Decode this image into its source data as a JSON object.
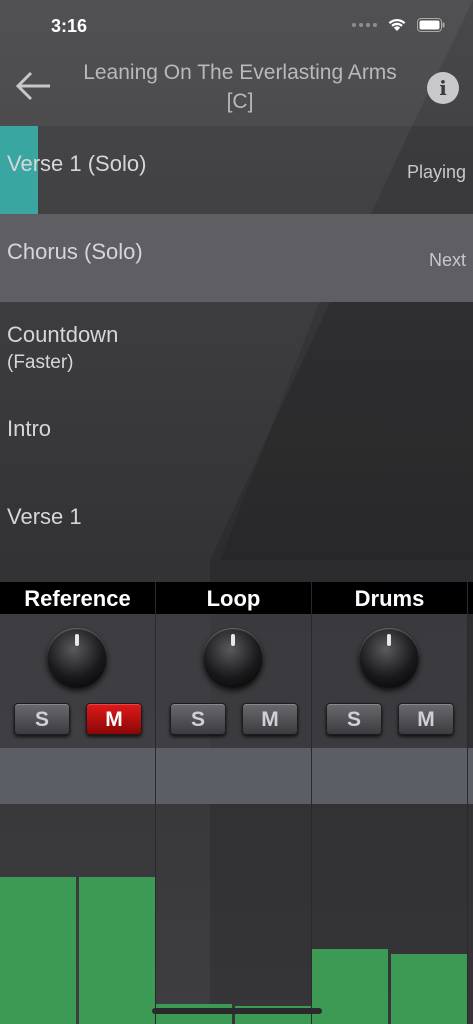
{
  "status_bar": {
    "time": "3:16"
  },
  "header": {
    "title_line1": "Leaning On The Everlasting Arms",
    "title_line2": "[C]",
    "back_icon": "arrow-left-icon",
    "info_glyph": "i"
  },
  "sections": [
    {
      "label": "Verse 1 (Solo)",
      "state": "Playing",
      "progress": 0.08
    },
    {
      "label": "Chorus (Solo)",
      "state": "Next"
    },
    {
      "label": "Countdown",
      "sublabel": "(Faster)",
      "state": ""
    },
    {
      "label": "Intro",
      "state": ""
    },
    {
      "label": "Verse 1",
      "state": ""
    }
  ],
  "channels": [
    {
      "name": "Reference",
      "solo_label": "S",
      "mute_label": "M",
      "muted": true,
      "levels": [
        0.67,
        0.67
      ]
    },
    {
      "name": "Loop",
      "solo_label": "S",
      "mute_label": "M",
      "muted": false,
      "levels": [
        0.09,
        0.08
      ]
    },
    {
      "name": "Drums",
      "solo_label": "S",
      "mute_label": "M",
      "muted": false,
      "levels": [
        0.34,
        0.32
      ]
    }
  ],
  "colors": {
    "playing_progress": "#3aa6a1",
    "mute_active": "#d01414",
    "meter": "#3d9a55"
  }
}
